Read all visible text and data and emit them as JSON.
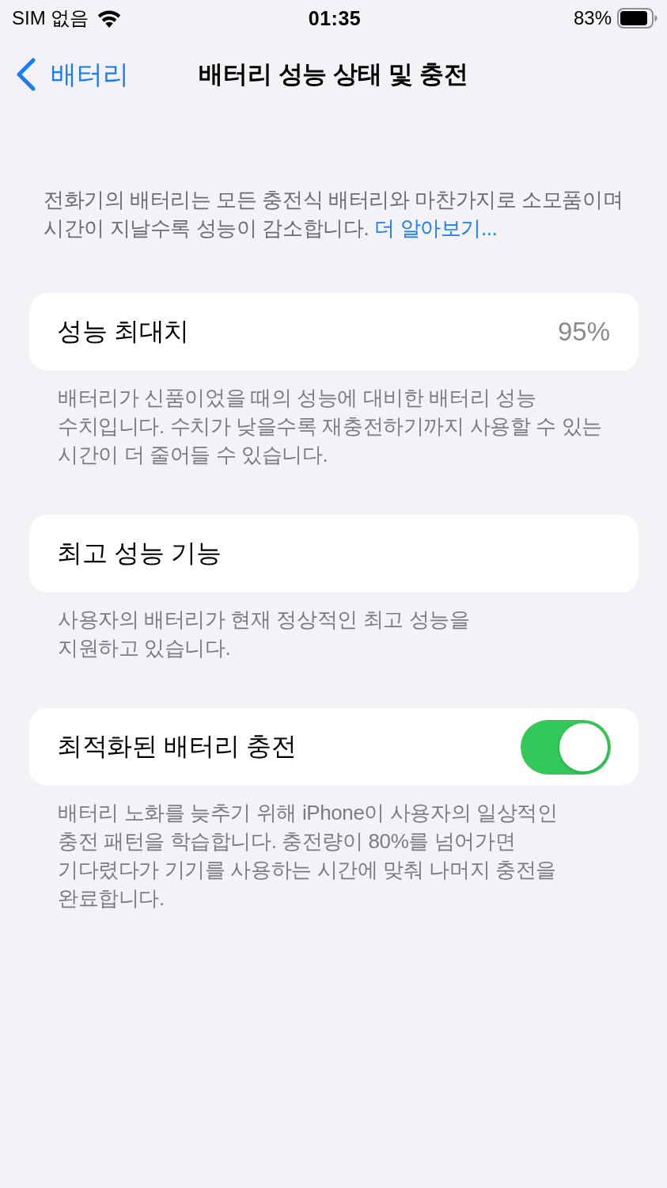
{
  "status_bar": {
    "carrier": "SIM 없음",
    "time": "01:35",
    "battery_percent": "83%"
  },
  "nav_bar": {
    "back_label": "배터리",
    "title": "배터리 성능 상태 및 충전"
  },
  "intro": {
    "text": "전화기의 배터리는 모든 충전식 배터리와 마찬가지로 소모품이며\n시간이 지날수록 성능이 감소합니다.",
    "link": "더 알아보기..."
  },
  "sections": [
    {
      "kind": "value",
      "label": "성능 최대치",
      "value": "95%",
      "footer": "배터리가 신품이었을 때의 성능에 대비한 배터리 성능\n수치입니다. 수치가 낮을수록 재충전하기까지 사용할 수 있는\n시간이 더 줄어들 수 있습니다."
    },
    {
      "kind": "plain",
      "label": "최고 성능 기능",
      "footer": "사용자의 배터리가 현재 정상적인 최고 성능을\n지원하고 있습니다."
    },
    {
      "kind": "toggle",
      "label": "최적화된 배터리 충전",
      "on": true,
      "footer": "배터리 노화를 늦추기 위해 iPhone이 사용자의 일상적인\n충전 패턴을 학습합니다. 충전량이 80%를 넘어가면\n기다렸다가 기기를 사용하는 시간에 맞춰 나머지 충전을\n완료합니다."
    }
  ]
}
